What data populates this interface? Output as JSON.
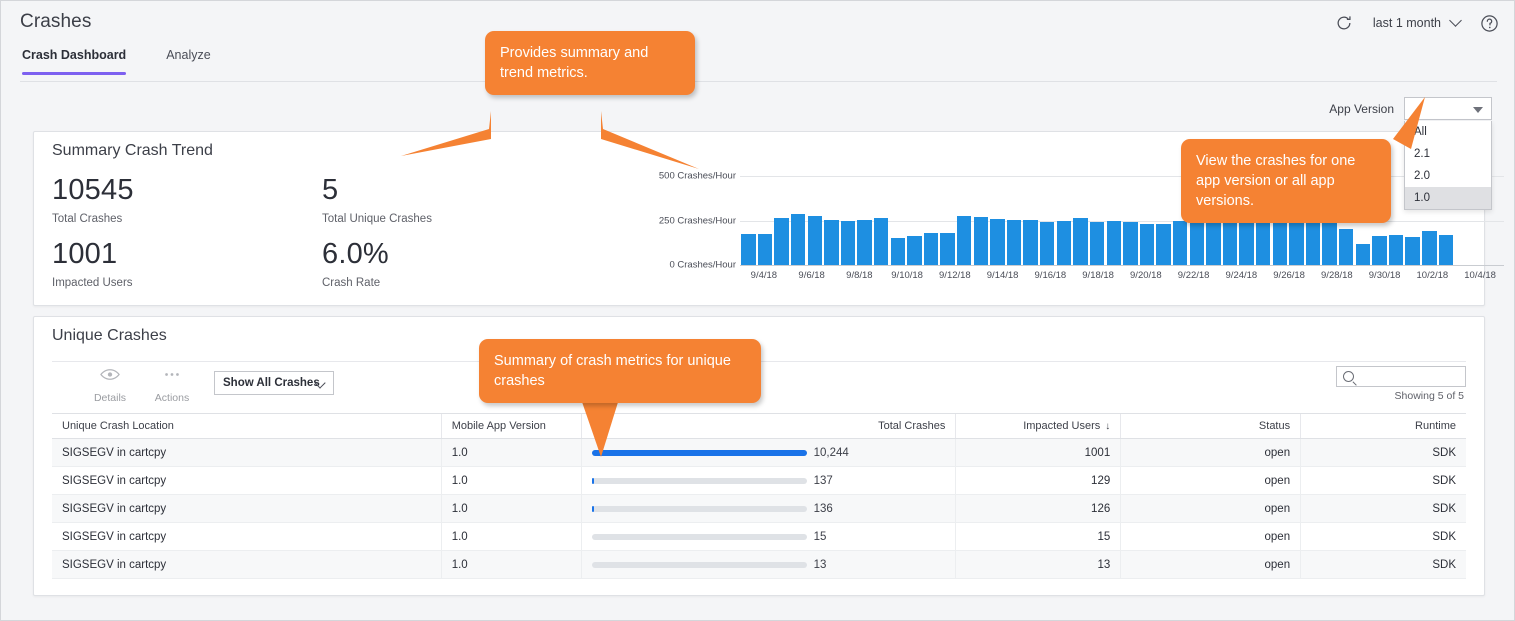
{
  "header": {
    "title": "Crashes",
    "refresh_icon": "refresh-icon",
    "help_icon": "help-icon",
    "time_range": "last 1 month",
    "tabs": [
      {
        "label": "Crash Dashboard",
        "active": true
      },
      {
        "label": "Analyze",
        "active": false
      }
    ]
  },
  "app_version": {
    "label": "App Version",
    "value": "",
    "options": [
      "All",
      "2.1",
      "2.0",
      "1.0"
    ],
    "selected": "1.0"
  },
  "summary": {
    "title": "Summary Crash Trend",
    "kpis": [
      {
        "value": "10545",
        "label": "Total Crashes"
      },
      {
        "value": "5",
        "label": "Total Unique Crashes"
      },
      {
        "value": "1001",
        "label": "Impacted Users"
      },
      {
        "value": "6.0%",
        "label": "Crash Rate"
      }
    ]
  },
  "chart_data": {
    "type": "bar",
    "title": "",
    "xlabel": "",
    "ylabel": "Crashes/Hour",
    "ylim": [
      0,
      500
    ],
    "yticks": [
      0,
      250,
      500
    ],
    "ytick_labels": [
      "0 Crashes/Hour",
      "250 Crashes/Hour",
      "500 Crashes/Hour"
    ],
    "grid": true,
    "legend": false,
    "x_tick_labels": [
      "9/4/18",
      "9/6/18",
      "9/8/18",
      "9/10/18",
      "9/12/18",
      "9/14/18",
      "9/16/18",
      "9/18/18",
      "9/20/18",
      "9/22/18",
      "9/24/18",
      "9/26/18",
      "9/28/18",
      "9/30/18",
      "10/2/18",
      "10/4/18"
    ],
    "x_axis_start": "9/3/18",
    "x_axis_end": "10/5/18",
    "categories": [
      "9/4/18",
      "9/4/18",
      "9/5/18",
      "9/5/18",
      "9/6/18",
      "9/6/18",
      "9/7/18",
      "9/7/18",
      "9/8/18",
      "9/8/18",
      "9/9/18",
      "9/9/18",
      "9/10/18",
      "9/10/18",
      "9/11/18",
      "9/11/18",
      "9/12/18",
      "9/12/18",
      "9/13/18",
      "9/13/18",
      "9/14/18",
      "9/14/18",
      "9/15/18",
      "9/15/18",
      "9/16/18",
      "9/16/18",
      "9/17/18",
      "9/17/18",
      "9/18/18",
      "9/18/18",
      "9/19/18",
      "9/19/18",
      "9/20/18",
      "9/20/18",
      "9/21/18",
      "9/21/18",
      "9/22/18",
      "9/22/18",
      "9/23/18",
      "9/23/18",
      "9/24/18",
      "9/24/18",
      "9/25/18",
      "9/25/18",
      "9/26/18",
      "9/26/18"
    ],
    "values": [
      175,
      172,
      262,
      285,
      278,
      255,
      248,
      255,
      263,
      150,
      165,
      182,
      180,
      275,
      272,
      258,
      252,
      254,
      244,
      250,
      262,
      243,
      248,
      240,
      233,
      228,
      250,
      265,
      245,
      262,
      238,
      250,
      254,
      252,
      258,
      262,
      200,
      120,
      165,
      168,
      160,
      190,
      170,
      0,
      0,
      0
    ],
    "bar_color": "#1e8fe1"
  },
  "unique_crashes": {
    "title": "Unique Crashes",
    "toolbar": {
      "details_label": "Details",
      "details_icon": "eye-icon",
      "actions_label": "Actions",
      "actions_icon": "ellipsis-icon",
      "filter_value": "Show All Crashes",
      "search_placeholder": "",
      "search_value": "",
      "search_icon": "search-icon",
      "showing": "Showing 5 of 5"
    },
    "columns": [
      {
        "label": "Unique Crash Location",
        "align": "left"
      },
      {
        "label": "Mobile App Version",
        "align": "left"
      },
      {
        "label": "Total Crashes",
        "align": "right",
        "sorted": false
      },
      {
        "label": "Impacted Users",
        "align": "right",
        "sorted": true,
        "sort_dir": "desc"
      },
      {
        "label": "Status",
        "align": "right"
      },
      {
        "label": "Runtime",
        "align": "right"
      }
    ],
    "rows": [
      {
        "location": "SIGSEGV in cartcpy",
        "version": "1.0",
        "total_crashes": "10,244",
        "bar_pct": 100,
        "impacted_users": "1001",
        "status": "open",
        "runtime": "SDK"
      },
      {
        "location": "SIGSEGV in cartcpy",
        "version": "1.0",
        "total_crashes": "137",
        "bar_pct": 1.3,
        "impacted_users": "129",
        "status": "open",
        "runtime": "SDK"
      },
      {
        "location": "SIGSEGV in cartcpy",
        "version": "1.0",
        "total_crashes": "136",
        "bar_pct": 1.3,
        "impacted_users": "126",
        "status": "open",
        "runtime": "SDK"
      },
      {
        "location": "SIGSEGV in cartcpy",
        "version": "1.0",
        "total_crashes": "15",
        "bar_pct": 0,
        "impacted_users": "15",
        "status": "open",
        "runtime": "SDK"
      },
      {
        "location": "SIGSEGV in cartcpy",
        "version": "1.0",
        "total_crashes": "13",
        "bar_pct": 0,
        "impacted_users": "13",
        "status": "open",
        "runtime": "SDK"
      }
    ]
  },
  "callouts": [
    {
      "id": "summary",
      "text": "Provides summary and trend metrics."
    },
    {
      "id": "version",
      "text": "View the crashes for one app version or all app versions."
    },
    {
      "id": "unique",
      "text": "Summary of crash metrics for unique crashes"
    }
  ],
  "colors": {
    "accent_tab": "#7d60f0",
    "bar_blue": "#1e8fe1",
    "row_bar_blue": "#1a73e8",
    "callout_orange": "#f58233"
  }
}
